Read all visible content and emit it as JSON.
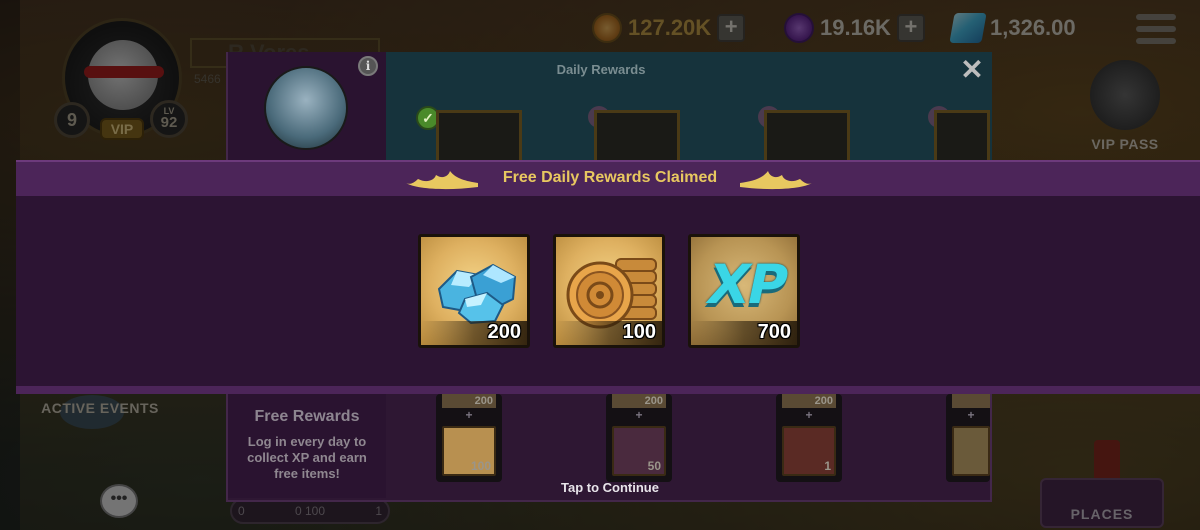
{
  "topbar": {
    "coins": "127.20K",
    "tokens": "19.16K",
    "gems": "1,326.00",
    "plus": "+"
  },
  "player": {
    "name_partial": "R Vores",
    "xp_partial": "5466",
    "rank": "9",
    "vip": "VIP",
    "level_prefix": "LV",
    "level": "92"
  },
  "side": {
    "vip_pass": "VIP PASS",
    "active_events": "ACTIVE EVENTS",
    "places": "PLACES",
    "chat": "•••"
  },
  "bottom_progress": {
    "left": "0",
    "mid": "0 100",
    "right": "1"
  },
  "daily_rewards": {
    "title": "Daily Rewards",
    "close": "✕",
    "info": "i",
    "free_rewards_title": "Free Rewards",
    "free_rewards_desc": "Log in every day to collect XP and earn free items!",
    "tap_to_continue": "Tap to Continue",
    "columns": [
      {
        "top": "200",
        "plus": "+",
        "bottom": "100"
      },
      {
        "top": "200",
        "plus": "+",
        "bottom": "50"
      },
      {
        "top": "200",
        "plus": "+",
        "bottom": "1"
      },
      {
        "top": "",
        "plus": "+",
        "bottom": ""
      }
    ]
  },
  "claimed": {
    "title": "Free Daily Rewards Claimed",
    "rewards": [
      {
        "icon": "gems-icon",
        "value": "200"
      },
      {
        "icon": "coins-icon",
        "value": "100"
      },
      {
        "icon": "xp-icon",
        "label": "XP",
        "value": "700"
      }
    ]
  },
  "colors": {
    "banner_header": "#4c2559",
    "banner_body": "#2c1433",
    "title_gold": "#e8c860",
    "card_gold": "#deb060",
    "xp_cyan": "#3ad6e6"
  }
}
